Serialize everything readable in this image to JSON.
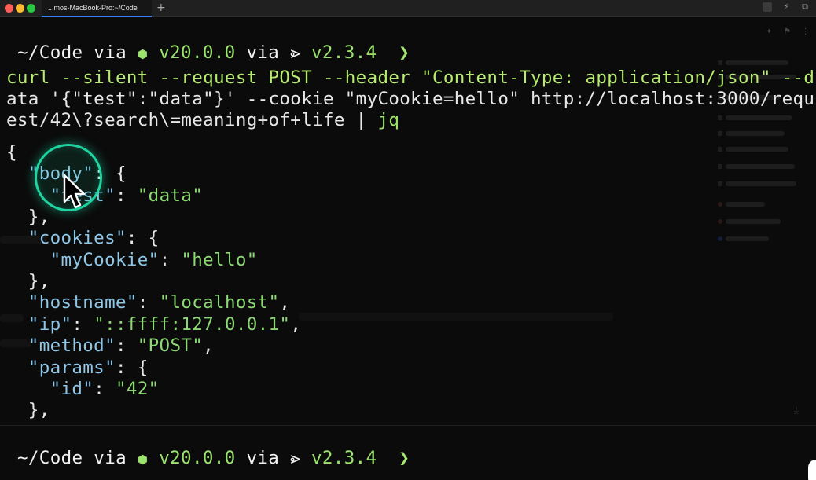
{
  "window": {
    "tab_title": "...mos-MacBook-Pro:~/Code",
    "new_tab_symbol": "+"
  },
  "prompt": {
    "path": "~/Code",
    "via1": "via",
    "node_icon": "⬢",
    "node_version": "v20.0.0",
    "via2": "via",
    "tool_icon": "⩺",
    "tool_version": "v2.3.4",
    "chevron": "❯"
  },
  "command": {
    "line1": "curl --silent --request POST --header \"Content-Type: application/json\" --d",
    "line2": "ata '{\"test\":\"data\"}' --cookie \"myCookie=hello\" http://localhost:3000/requ",
    "line3_main": "est/42\\?search\\=meaning+of+life | ",
    "line3_pipe_target": "jq"
  },
  "output": {
    "open_brace": "{",
    "body_key": "\"body\"",
    "test_key": "\"test\"",
    "test_val": "\"data\"",
    "cookies_key": "\"cookies\"",
    "mycookie_key": "\"myCookie\"",
    "mycookie_val": "\"hello\"",
    "hostname_key": "\"hostname\"",
    "hostname_val": "\"localhost\"",
    "ip_key": "\"ip\"",
    "ip_val": "\"::ffff:127.0.0.1\"",
    "method_key": "\"method\"",
    "method_val": "\"POST\"",
    "params_key": "\"params\"",
    "id_key": "\"id\"",
    "id_val": "\"42\""
  },
  "colors": {
    "background": "#0b0b0b",
    "json_key": "#8ec7e8",
    "json_string": "#8bd874",
    "prompt_accent": "#9be36d",
    "cursor_ring": "#1ed4a0",
    "active_tab_underline": "#3b82f6"
  },
  "icons": [
    "node-icon",
    "tool-icon",
    "chevron-icon",
    "lightning-icon",
    "split-window-icon",
    "pin-icon",
    "bookmark-icon",
    "more-icon",
    "download-icon",
    "mouse-pointer-icon"
  ]
}
